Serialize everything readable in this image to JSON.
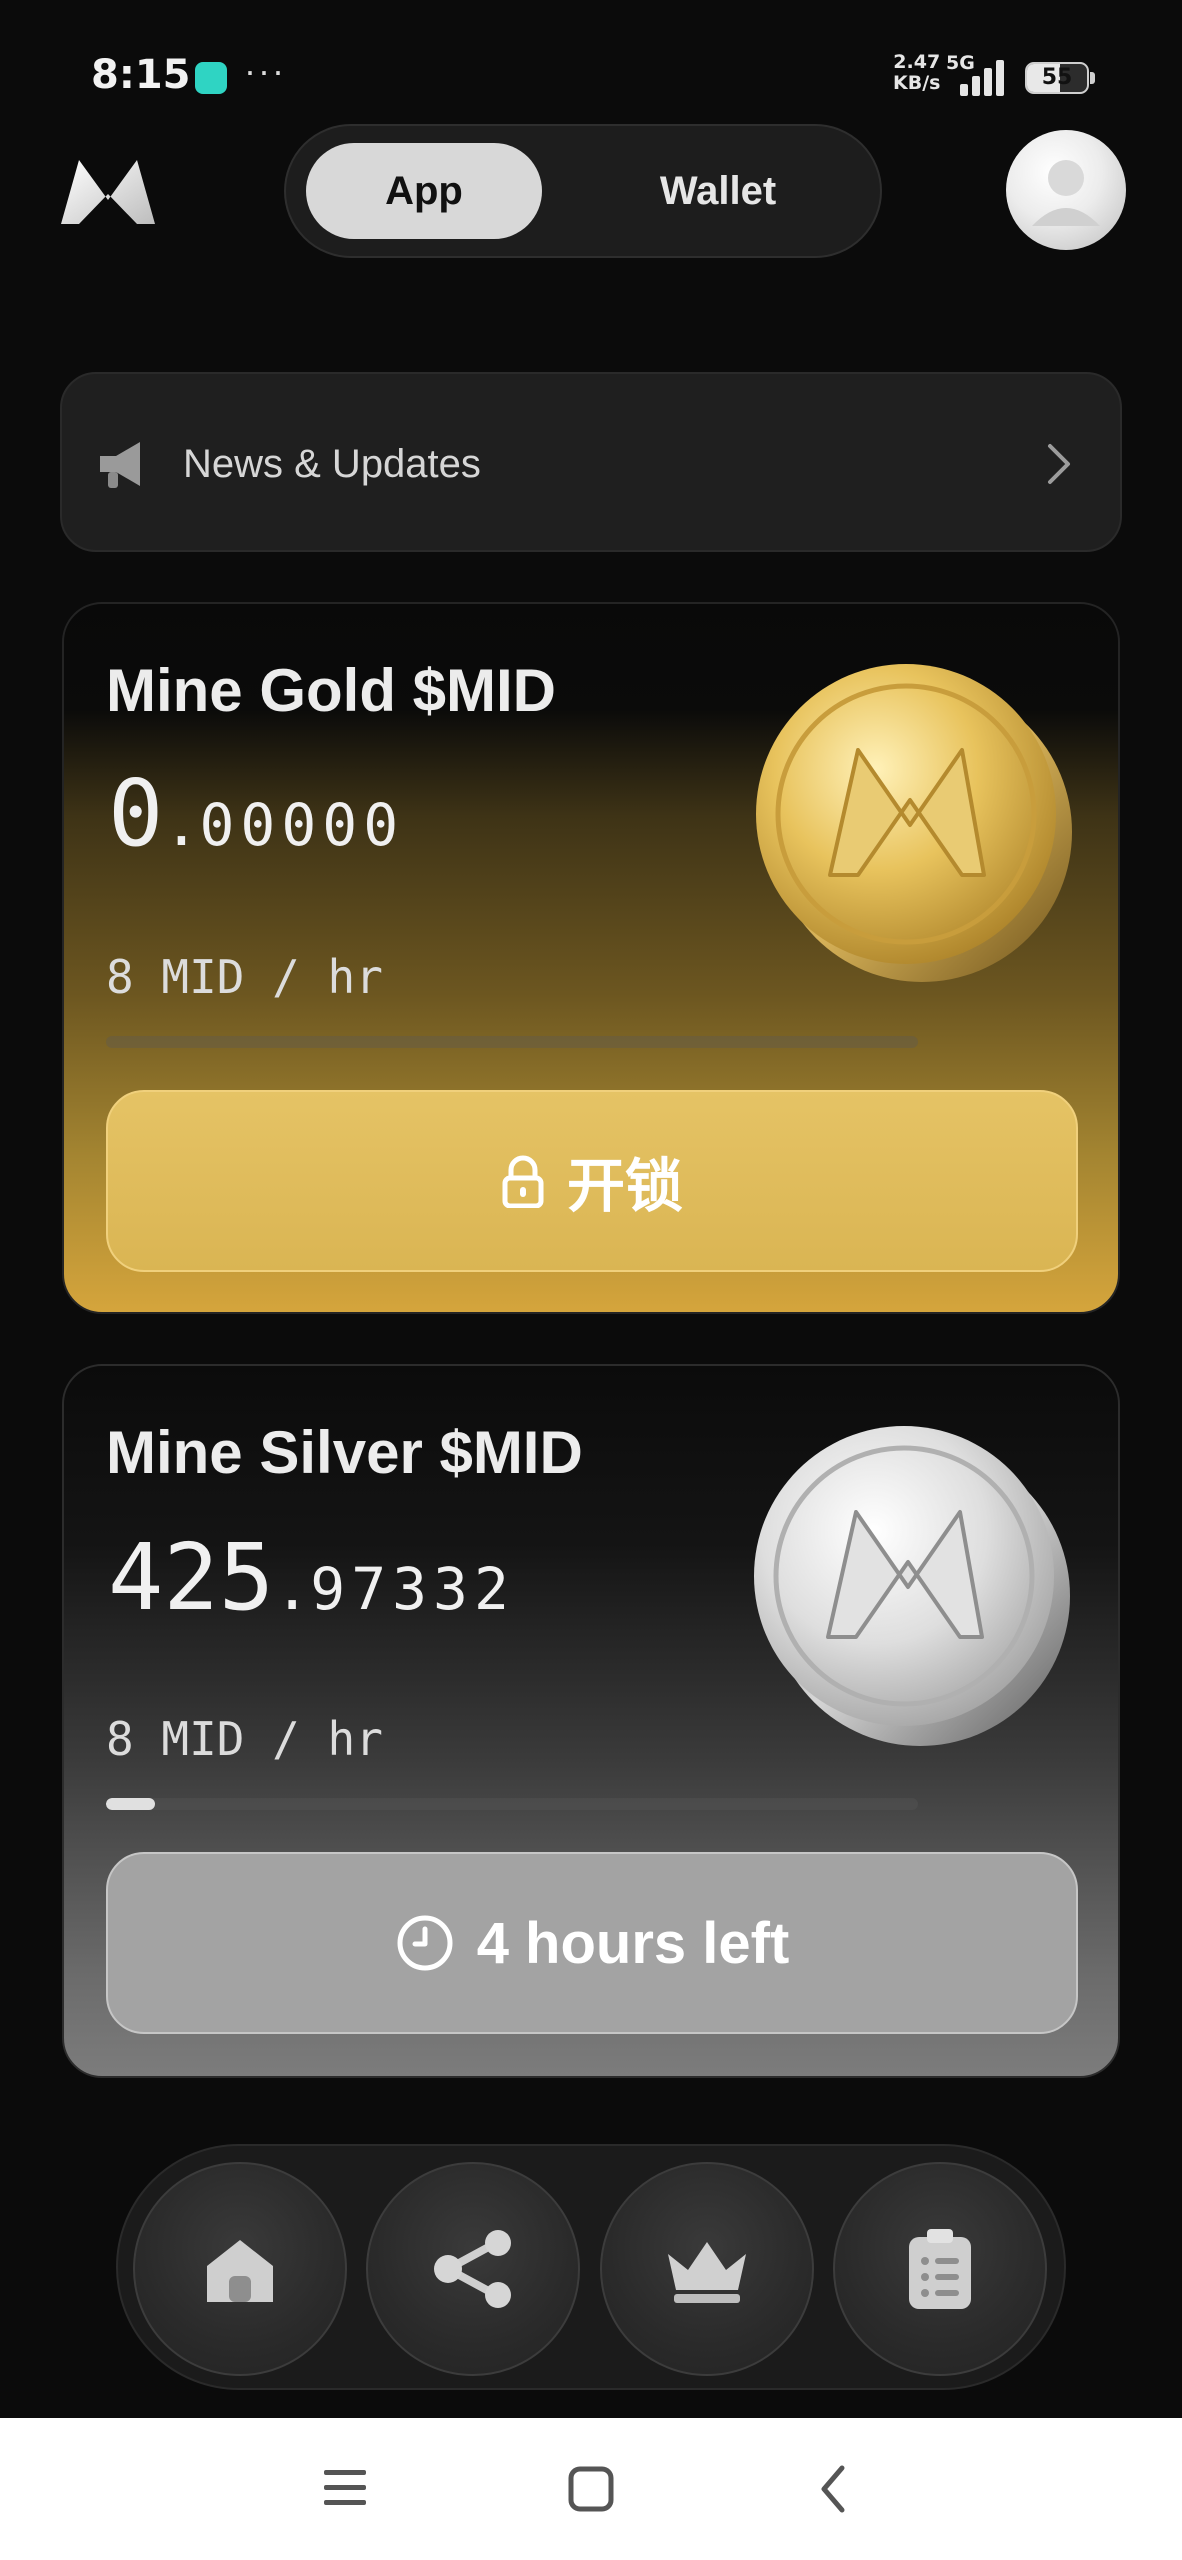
{
  "status_bar": {
    "time": "8:15",
    "more": "···",
    "speed_value": "2.47",
    "speed_unit": "KB/s",
    "network": "5G",
    "battery": "55"
  },
  "header": {
    "tabs": [
      {
        "label": "App",
        "active": true
      },
      {
        "label": "Wallet",
        "active": false
      }
    ]
  },
  "news": {
    "label": "News & Updates"
  },
  "cards": [
    {
      "title": "Mine Gold $MID",
      "balance_int": "0",
      "balance_dot": ".",
      "balance_dec": "00000",
      "rate": "8 MID / hr",
      "progress": 0.0,
      "button_label": "开锁",
      "button_icon": "lock-icon",
      "accent": "#d8b255"
    },
    {
      "title": "Mine Silver $MID",
      "balance_int": "425",
      "balance_dot": ".",
      "balance_dec": "97332",
      "rate": "8 MID / hr",
      "progress": 0.06,
      "button_label": "4 hours left",
      "button_icon": "clock-icon",
      "accent": "#a3a3a3"
    }
  ],
  "bottom_nav": [
    {
      "icon": "home-icon"
    },
    {
      "icon": "share-icon"
    },
    {
      "icon": "crown-icon"
    },
    {
      "icon": "clipboard-icon"
    }
  ],
  "system_nav": [
    {
      "icon": "menu-icon"
    },
    {
      "icon": "home-square-icon"
    },
    {
      "icon": "back-icon"
    }
  ]
}
